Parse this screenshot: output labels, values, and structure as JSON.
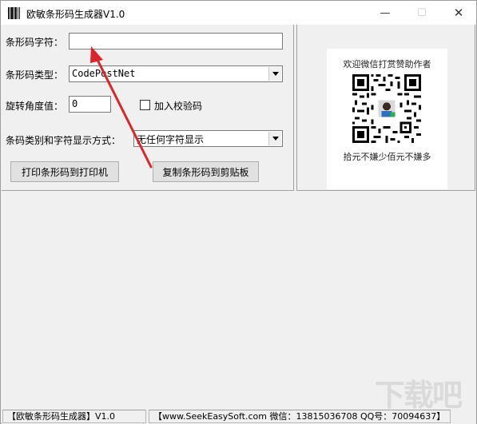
{
  "window": {
    "title": "欧敏条形码生成器V1.0",
    "min_glyph": "—",
    "max_glyph": "☐",
    "close_glyph": "✕"
  },
  "form": {
    "barcode_text_label": "条形码字符：",
    "barcode_text_value": "",
    "barcode_type_label": "条形码类型：",
    "barcode_type_value": "CodePostNet",
    "rotation_label": "旋转角度值：",
    "rotation_value": "0",
    "checksum_label": "加入校验码",
    "checksum_checked": false,
    "display_mode_label": "条码类别和字符显示方式：",
    "display_mode_value": "无任何字符显示",
    "print_button": "打印条形码到打印机",
    "copy_button": "复制条形码到剪贴板"
  },
  "donation": {
    "caption_top": "欢迎微信打赏赞助作者",
    "caption_bottom": "拾元不嫌少佰元不嫌多"
  },
  "statusbar": {
    "left": "【欧敏条形码生成器】V1.0",
    "right": "【www.SeekEasySoft.com 微信：13815036708 QQ号：70094637】"
  },
  "colors": {
    "arrow": "#d9262b",
    "window_bg": "#f0f0f0"
  }
}
